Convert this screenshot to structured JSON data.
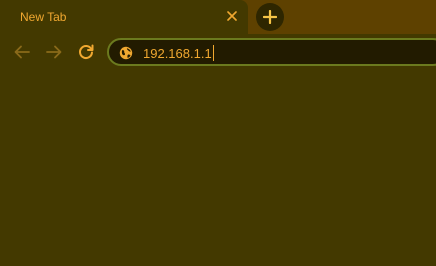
{
  "tab": {
    "title": "New Tab"
  },
  "omnibox": {
    "text": "192.168.1.1"
  },
  "icons": {
    "close": "close-icon",
    "new_tab": "plus-icon",
    "back": "arrow-left-icon",
    "forward": "arrow-right-icon",
    "reload": "reload-icon",
    "site": "globe-icon"
  },
  "colors": {
    "frame": "#5e4100",
    "toolbar": "#433900",
    "accent": "#f0a830",
    "omnibox_bg": "#221b00",
    "omnibox_border": "#6b7a1e"
  }
}
